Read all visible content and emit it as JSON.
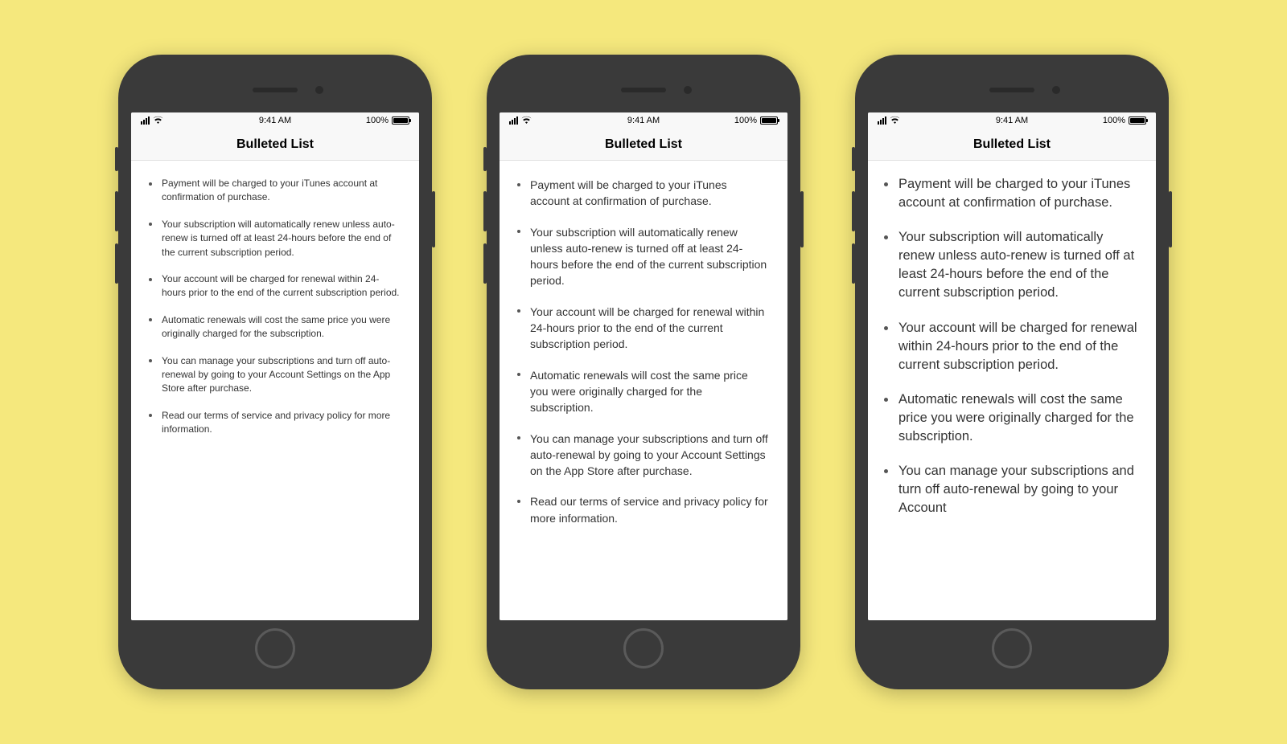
{
  "statusBar": {
    "time": "9:41 AM",
    "battery": "100%"
  },
  "title": "Bulleted List",
  "bullets": [
    "Payment will be charged to your iTunes account at confirmation of purchase.",
    "Your subscription will automatically renew unless auto-renew is turned off at least 24-hours before the end of the current subscription period.",
    "Your account will be charged for renewal within 24-hours prior to the end of the current subscription period.",
    "Automatic renewals will cost the same price you were originally charged for the subscription.",
    "You can manage your subscriptions and turn off auto-renewal by going to your Account Settings on the App Store after purchase.",
    "Read our terms of service and privacy policy for more information."
  ],
  "bullets_large_visible": [
    "Payment will be charged to your iTunes account at confirmation of purchase.",
    "Your subscription will automatically renew unless auto-renew is turned off at least 24-hours before the end of the current subscription period.",
    "Your account will be charged for renewal within 24-hours prior to the end of the current subscription period.",
    "Automatic renewals will cost the same price you were originally charged for the subscription.",
    "You can manage your subscriptions and turn off auto-renewal by going to your Account"
  ]
}
